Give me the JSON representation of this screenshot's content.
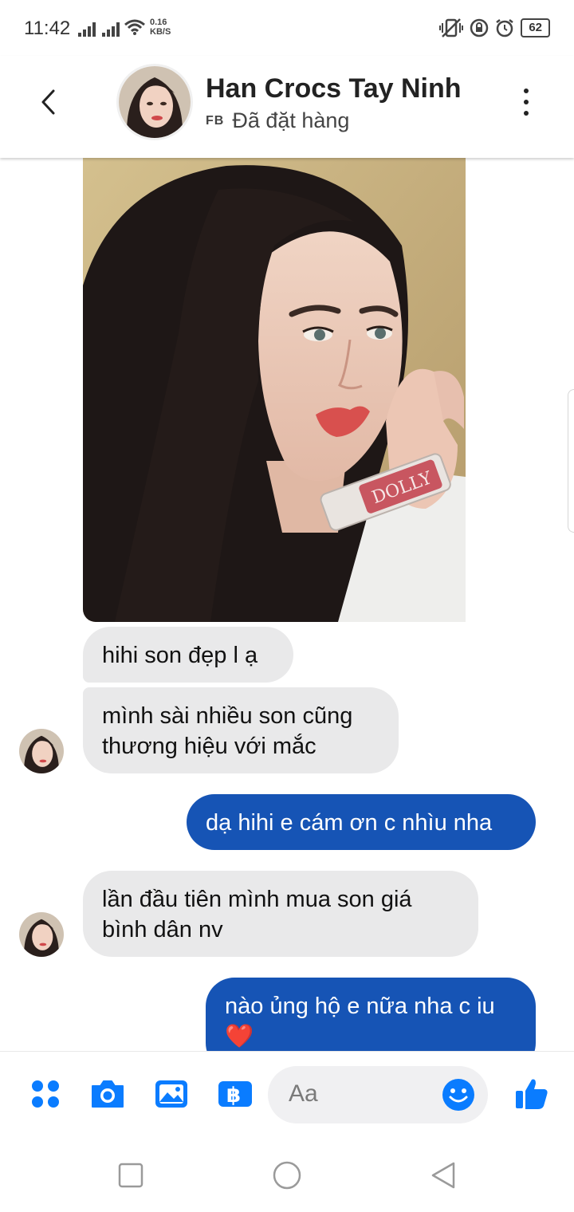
{
  "status_bar": {
    "time": "11:42",
    "net_speed_value": "0.16",
    "net_speed_unit": "KB/S",
    "battery": "62"
  },
  "header": {
    "contact_name": "Han Crocs Tay Ninh",
    "source_tag": "FB",
    "status_text": "Đã đặt hàng"
  },
  "messages": [
    {
      "direction": "incoming",
      "text": "hihi son đẹp l ạ"
    },
    {
      "direction": "incoming",
      "text": "mình sài nhiều son cũng thương hiệu với mắc"
    },
    {
      "direction": "outgoing",
      "text": "dạ hihi e cám ơn c nhìu nha"
    },
    {
      "direction": "incoming",
      "text": "lần đầu tiên mình mua son giá bình dân nv"
    },
    {
      "direction": "outgoing",
      "text": "nào ủng hộ e nữa nha c iu ❤️"
    }
  ],
  "photo_lipstick_brand": "DOLLY",
  "composer": {
    "placeholder": "Aa"
  },
  "colors": {
    "messenger_blue": "#0a7cff",
    "outgoing_bubble": "#1654b5",
    "incoming_bubble": "#e9e9ea"
  }
}
